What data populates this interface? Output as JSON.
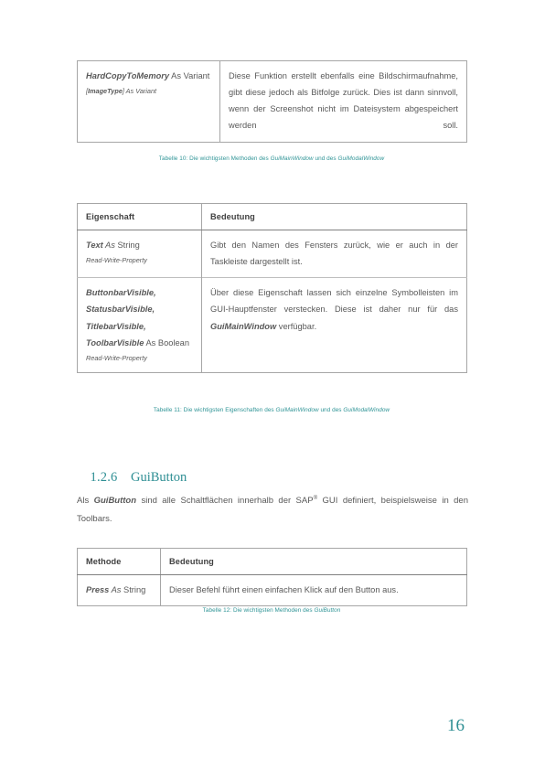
{
  "document": {
    "page_number": "16",
    "accent_color": "#2f8f94",
    "caption_color": "#2f9496",
    "text_color": "#595959"
  },
  "table10": {
    "rows": [
      {
        "name_bold": "HardCopyToMemory",
        "name_rest": " As Variant",
        "sub_prefix": "[",
        "sub_bold": "ImageType",
        "sub_rest": "] As Variant",
        "description": "Diese Funktion erstellt ebenfalls eine Bildschirmaufnahme, gibt diese jedoch als Bitfolge zurück. Dies ist dann sinnvoll, wenn der Screenshot nicht im Dateisystem abgespeichert werden soll."
      }
    ],
    "caption_prefix": "Tabelle 10: Die wichtigsten Methoden des ",
    "caption_em1": "GuiMainWindow",
    "caption_mid": " und des ",
    "caption_em2": "GuiModalWindow"
  },
  "table11": {
    "header": {
      "col1": "Eigenschaft",
      "col2": "Bedeutung"
    },
    "rows": [
      {
        "name_bold": "Text",
        "name_italic": " As ",
        "name_rest": "String",
        "sub": "Read-Write-Property",
        "description": "Gibt den Namen des Fensters zurück, wie er auch in der Taskleiste dargestellt ist."
      },
      {
        "name_bold": "ButtonbarVisible, StatusbarVisible, TitlebarVisible, ToolbarVisible",
        "name_rest": " As Boolean",
        "sub": "Read-Write-Property",
        "desc_prefix": "Über diese Eigenschaft lassen sich einzelne Symbolleisten im GUI-Hauptfenster verstecken. Diese ist daher nur für das ",
        "desc_em": "GuiMainWindow",
        "desc_suffix": " verfügbar."
      }
    ],
    "caption_prefix": "Tabelle 11: Die wichtigsten Eigenschaften des ",
    "caption_em1": "GuiMainWindow",
    "caption_mid": " und des ",
    "caption_em2": "GuiModalWindow"
  },
  "section": {
    "number": "1.2.6",
    "title": "GuiButton"
  },
  "paragraph": {
    "prefix": "Als ",
    "em": "GuiButton",
    "mid": " sind alle Schaltflächen innerhalb der SAP",
    "sup": "®",
    "suffix": " GUI definiert, beispielsweise in den Toolbars."
  },
  "table12": {
    "header": {
      "col1": "Methode",
      "col2": "Bedeutung"
    },
    "rows": [
      {
        "name_bold": "Press",
        "name_italic": " As ",
        "name_rest": "String",
        "description": "Dieser Befehl führt einen einfachen Klick auf den Button aus."
      }
    ],
    "caption_prefix": "Tabelle 12: Die wichtigsten Methoden des ",
    "caption_em1": "GuiButton"
  }
}
